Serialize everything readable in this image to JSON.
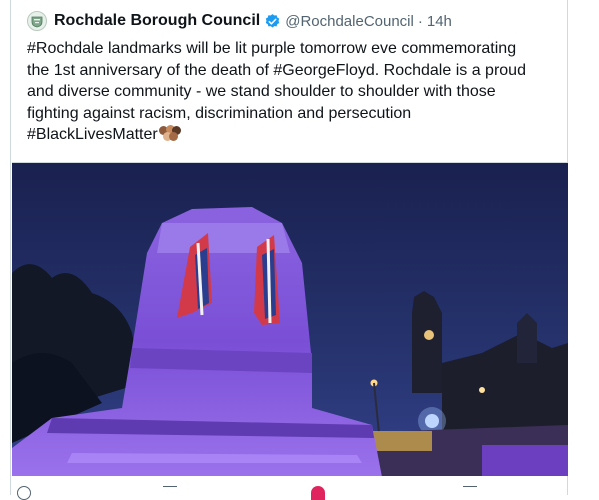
{
  "tweet": {
    "display_name": "Rochdale Borough Council",
    "handle": "@RochdaleCouncil",
    "separator": "·",
    "timestamp": "14h",
    "verified": true,
    "text_lines": [
      "#Rochdale landmarks will be lit purple tomorrow eve commemorating",
      "the 1st anniversary of the death of #GeorgeFloyd. Rochdale is a proud",
      "and diverse community - we stand shoulder to shoulder with those",
      "fighting against racism, discrimination and persecution",
      "#BlackLivesMatter"
    ],
    "emoji": "fist-skin-tones-emoji"
  },
  "media": {
    "icons": [
      "cenotaph-illuminated-purple",
      "union-flag",
      "town-hall-clock-tower",
      "street-lamps"
    ],
    "sky_color": "#1f2a5c",
    "monument_color": "#7a4fd6"
  },
  "actions": {
    "icons": [
      "reply-icon",
      "retweet-icon",
      "like-icon",
      "share-icon"
    ],
    "like_color": "#e0245e"
  }
}
